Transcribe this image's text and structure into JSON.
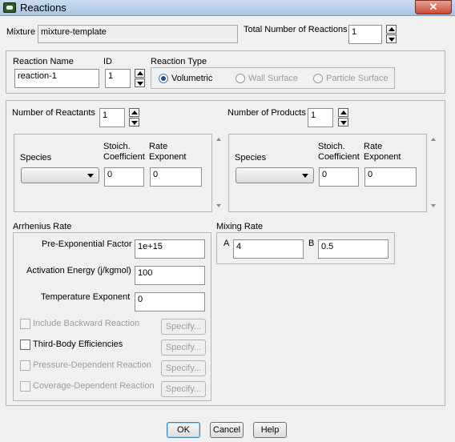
{
  "window": {
    "title": "Reactions",
    "close_glyph": "✕"
  },
  "mixture": {
    "label": "Mixture",
    "value": "mixture-template"
  },
  "total_reactions": {
    "label": "Total Number of Reactions",
    "value": "1"
  },
  "reaction": {
    "name_label": "Reaction Name",
    "name_value": "reaction-1",
    "id_label": "ID",
    "id_value": "1",
    "type_label": "Reaction Type",
    "types": [
      "Volumetric",
      "Wall Surface",
      "Particle Surface"
    ],
    "selected_type": "Volumetric"
  },
  "reactants": {
    "count_label": "Number of Reactants",
    "count_value": "1",
    "species_header": "Species",
    "stoich_header_1": "Stoich.",
    "stoich_header_2": "Coefficient",
    "rate_header_1": "Rate",
    "rate_header_2": "Exponent",
    "stoich_value": "0",
    "rate_value": "0"
  },
  "products": {
    "count_label": "Number of Products",
    "count_value": "1",
    "species_header": "Species",
    "stoich_header_1": "Stoich.",
    "stoich_header_2": "Coefficient",
    "rate_header_1": "Rate",
    "rate_header_2": "Exponent",
    "stoich_value": "0",
    "rate_value": "0"
  },
  "arrhenius": {
    "title": "Arrhenius Rate",
    "pre_exp_label": "Pre-Exponential Factor",
    "pre_exp_value": "1e+15",
    "activation_label": "Activation Energy (j/kgmol)",
    "activation_value": "100",
    "temp_exp_label": "Temperature Exponent",
    "temp_exp_value": "0",
    "options": [
      {
        "label": "Include Backward Reaction",
        "enabled": false
      },
      {
        "label": "Third-Body Efficiencies",
        "enabled": true
      },
      {
        "label": "Pressure-Dependent Reaction",
        "enabled": false
      },
      {
        "label": "Coverage-Dependent Reaction",
        "enabled": false
      }
    ],
    "specify_label": "Specify..."
  },
  "mixing": {
    "title": "Mixing Rate",
    "a_label": "A",
    "a_value": "4",
    "b_label": "B",
    "b_value": "0.5"
  },
  "buttons": {
    "ok": "OK",
    "cancel": "Cancel",
    "help": "Help"
  },
  "colors": {
    "title_bar": "#b5cde8",
    "close_button": "#c64a33",
    "dialog_bg": "#f0f0f0"
  }
}
